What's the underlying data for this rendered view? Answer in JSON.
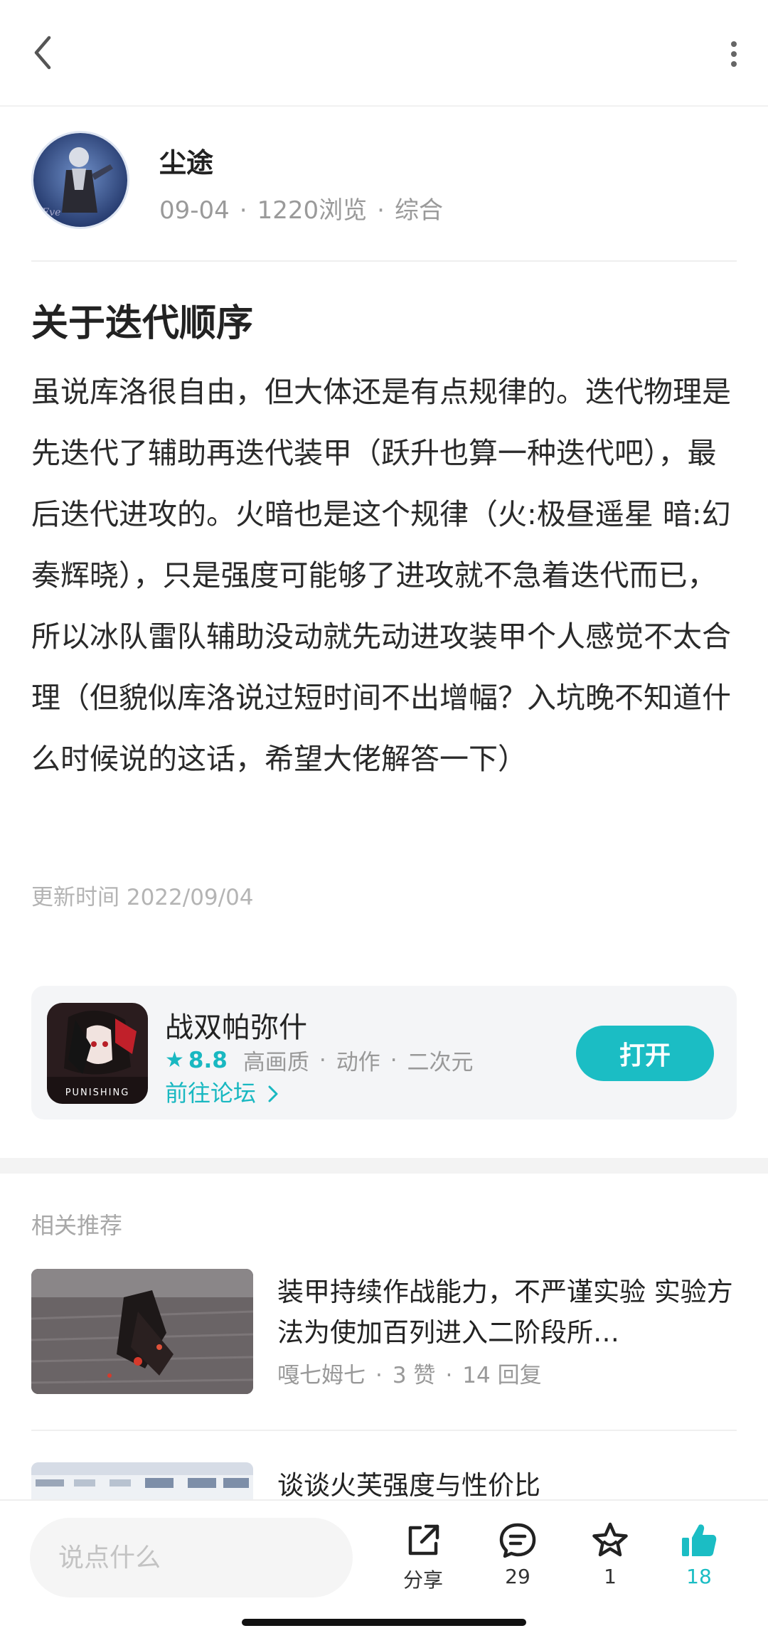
{
  "topbar": {
    "back_icon": "chevron-left-icon",
    "more_icon": "more-vertical-icon"
  },
  "author": {
    "name": "尘途",
    "date": "09-04",
    "views": "1220浏览",
    "category": "综合"
  },
  "post": {
    "title": "关于迭代顺序",
    "body": "虽说库洛很自由，但大体还是有点规律的。迭代物理是先迭代了辅助再迭代装甲（跃升也算一种迭代吧），最后迭代进攻的。火暗也是这个规律（火:极昼遥星 暗:幻奏辉晓），只是强度可能够了进攻就不急着迭代而已，所以冰队雷队辅助没动就先动进攻装甲个人感觉不太合理（但貌似库洛说过短时间不出增幅？入坑晚不知道什么时候说的这话，希望大佬解答一下）",
    "updated": "更新时间 2022/09/04"
  },
  "game_card": {
    "name": "战双帕弥什",
    "rating": "8.8",
    "tags": [
      "高画质",
      "动作",
      "二次元"
    ],
    "forum_link": "前往论坛",
    "open_button": "打开",
    "icon_text": "PUNISHING",
    "accent": "#1bbdc4"
  },
  "related": {
    "title": "相关推荐",
    "items": [
      {
        "title": "装甲持续作战能力，不严谨实验 实验方法为使加百列进入二阶段所…",
        "author": "嘎七姆七",
        "likes": "3 赞",
        "replies": "14 回复"
      },
      {
        "title": "谈谈火芙强度与性价比"
      }
    ]
  },
  "bottom_bar": {
    "placeholder": "说点什么",
    "share_label": "分享",
    "comments": "29",
    "favorites": "1",
    "likes": "18"
  }
}
